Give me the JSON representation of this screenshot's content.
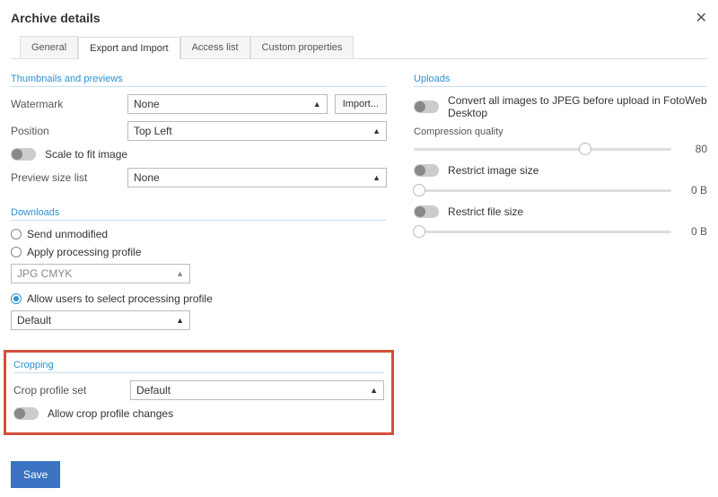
{
  "header": {
    "title": "Archive details"
  },
  "tabs": {
    "items": [
      {
        "label": "General"
      },
      {
        "label": "Export and Import"
      },
      {
        "label": "Access list"
      },
      {
        "label": "Custom properties"
      }
    ]
  },
  "thumbnails": {
    "title": "Thumbnails and previews",
    "watermark_label": "Watermark",
    "watermark_value": "None",
    "import_btn": "Import...",
    "position_label": "Position",
    "position_value": "Top Left",
    "scale_label": "Scale to fit image",
    "preview_label": "Preview size list",
    "preview_value": "None"
  },
  "downloads": {
    "title": "Downloads",
    "send_unmodified": "Send unmodified",
    "apply_profile": "Apply processing profile",
    "profile_value": "JPG CMYK",
    "allow_select": "Allow users to select processing profile",
    "default_value": "Default"
  },
  "cropping": {
    "title": "Cropping",
    "crop_set_label": "Crop profile set",
    "crop_set_value": "Default",
    "allow_changes": "Allow crop profile changes"
  },
  "uploads": {
    "title": "Uploads",
    "convert_jpeg": "Convert all images to JPEG before upload in FotoWeb Desktop",
    "compression_label": "Compression quality",
    "compression_value": "80",
    "restrict_image": "Restrict image size",
    "restrict_image_value": "0 B",
    "restrict_file": "Restrict file size",
    "restrict_file_value": "0 B"
  },
  "footer": {
    "save": "Save"
  }
}
